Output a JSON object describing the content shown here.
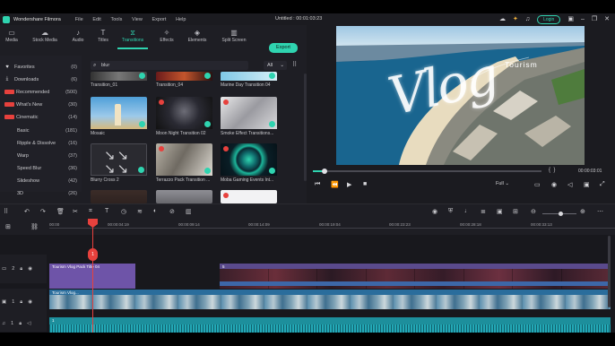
{
  "app": {
    "name": "Wondershare Filmora",
    "menu": [
      "File",
      "Edit",
      "Tools",
      "View",
      "Export",
      "Help"
    ],
    "doc_title": "Untitled : 00:01:03:23",
    "login_label": "Login",
    "export_label": "Export"
  },
  "tabs": [
    {
      "label": "Media",
      "icon": "folder-icon"
    },
    {
      "label": "Stock Media",
      "icon": "cloud-icon"
    },
    {
      "label": "Audio",
      "icon": "music-icon"
    },
    {
      "label": "Titles",
      "icon": "text-icon"
    },
    {
      "label": "Transitions",
      "icon": "transition-icon",
      "active": true
    },
    {
      "label": "Effects",
      "icon": "sparkle-icon"
    },
    {
      "label": "Elements",
      "icon": "shapes-icon"
    },
    {
      "label": "Split Screen",
      "icon": "split-icon"
    }
  ],
  "sidebar": {
    "items": [
      {
        "label": "Favorites",
        "count": "(0)",
        "icon": "heart-icon"
      },
      {
        "label": "Downloads",
        "count": "(6)",
        "icon": "download-icon"
      },
      {
        "label": "Recommended",
        "count": "(500)",
        "hot": true
      },
      {
        "label": "What's New",
        "count": "(30)",
        "hot": true
      },
      {
        "label": "Cinematic",
        "count": "(14)",
        "hot": true
      },
      {
        "label": "Basic",
        "count": "(181)",
        "sub": true
      },
      {
        "label": "Ripple & Dissolve",
        "count": "(16)",
        "sub": true
      },
      {
        "label": "Warp",
        "count": "(37)",
        "sub": true
      },
      {
        "label": "Speed Blur",
        "count": "(36)",
        "sub": true
      },
      {
        "label": "Slideshow",
        "count": "(42)",
        "sub": true
      },
      {
        "label": "3D",
        "count": "(26)",
        "sub": true
      }
    ]
  },
  "browser": {
    "search_value": "blur",
    "filter_value": "All",
    "items": [
      {
        "label": "Transition_01"
      },
      {
        "label": "Transition_04"
      },
      {
        "label": "Marine Day Transition 04"
      },
      {
        "label": "Mosaic"
      },
      {
        "label": "Moon Night Transition 02"
      },
      {
        "label": "Smoke Effect Transitions..."
      },
      {
        "label": "Blurry Cross 2"
      },
      {
        "label": "Terrazzo Pack Transition ..."
      },
      {
        "label": "Moba Gaming Events Int..."
      }
    ]
  },
  "preview": {
    "title_text": "Vlog",
    "overlay_text": "Tourism",
    "timecode": "00:00:03:01",
    "zoom": "Full",
    "progress": 0.05,
    "brace_left": "{",
    "brace_right": "}"
  },
  "timeline": {
    "ruler": [
      "00:00",
      "00:00:04:19",
      "00:00:09:14",
      "00:00:14:09",
      "00:00:19:04",
      "00:00:23:23",
      "00:00:28:18",
      "00:00:33:13"
    ],
    "playhead_label": "1",
    "tracks": [
      {
        "id": "2",
        "type": "title"
      },
      {
        "id": "1",
        "type": "video"
      },
      {
        "id": "1",
        "type": "audio"
      }
    ],
    "clips": {
      "title_clip": "Tourism Vlog Pack Title 04",
      "effect_clip": "5",
      "video_clip": "Tourism Vlog...",
      "audio_clip": "1"
    }
  },
  "colors": {
    "accent": "#2fd4b0",
    "playhead": "#e7413d"
  }
}
